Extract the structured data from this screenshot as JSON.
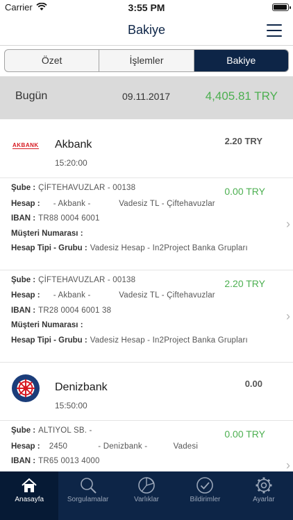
{
  "status": {
    "carrier": "Carrier",
    "time": "3:55 PM"
  },
  "nav": {
    "title": "Bakiye"
  },
  "segments": [
    {
      "label": "Özet"
    },
    {
      "label": "İşlemler"
    },
    {
      "label": "Bakiye"
    }
  ],
  "summary": {
    "label": "Bugün",
    "date": "09.11.2017",
    "amount": "4,405.81 TRY"
  },
  "colors": {
    "primary": "#0d2547",
    "positive": "#4caf50",
    "akbank": "#d71921"
  },
  "banks": [
    {
      "name": "Akbank",
      "logo_text": "AKBANK",
      "time": "15:20:00",
      "amount": "2.20 TRY",
      "accounts": [
        {
          "amount": "0.00 TRY",
          "sube_label": "Şube :",
          "sube": "ÇİFTEHAVUZLAR - 00138",
          "hesap_label": "Hesap :",
          "hesap": "- Akbank -            Vadesiz TL - Çiftehavuzlar",
          "iban_label": "IBAN :",
          "iban": "TR88 0004 6001",
          "musteri_label": "Müşteri Numarası :",
          "musteri": "",
          "tipi_label": "Hesap Tipi - Grubu :",
          "tipi": "Vadesiz Hesap - In2Project Banka Grupları"
        },
        {
          "amount": "2.20 TRY",
          "sube_label": "Şube :",
          "sube": "ÇİFTEHAVUZLAR - 00138",
          "hesap_label": "Hesap :",
          "hesap": "- Akbank -            Vadesiz TL - Çiftehavuzlar",
          "iban_label": "IBAN :",
          "iban": "TR28 0004 6001 38",
          "musteri_label": "Müşteri Numarası :",
          "musteri": "",
          "tipi_label": "Hesap Tipi - Grubu :",
          "tipi": "Vadesiz Hesap - In2Project Banka Grupları"
        }
      ]
    },
    {
      "name": "Denizbank",
      "time": "15:50:00",
      "amount": "0.00",
      "accounts": [
        {
          "amount": "0.00 TRY",
          "sube_label": "Şube :",
          "sube": "ALTIYOL SB. -",
          "hesap_label": "Hesap :",
          "hesap": "2450             - Denizbank -           Vadesi",
          "iban_label": "IBAN :",
          "iban": "TR65 0013 4000"
        }
      ]
    }
  ],
  "tabs": [
    {
      "label": "Anasayfa",
      "icon": "home-icon"
    },
    {
      "label": "Sorgulamalar",
      "icon": "search-icon"
    },
    {
      "label": "Varlıklar",
      "icon": "pie-chart-icon"
    },
    {
      "label": "Bildirimler",
      "icon": "check-circle-icon"
    },
    {
      "label": "Ayarlar",
      "icon": "gear-icon"
    }
  ]
}
